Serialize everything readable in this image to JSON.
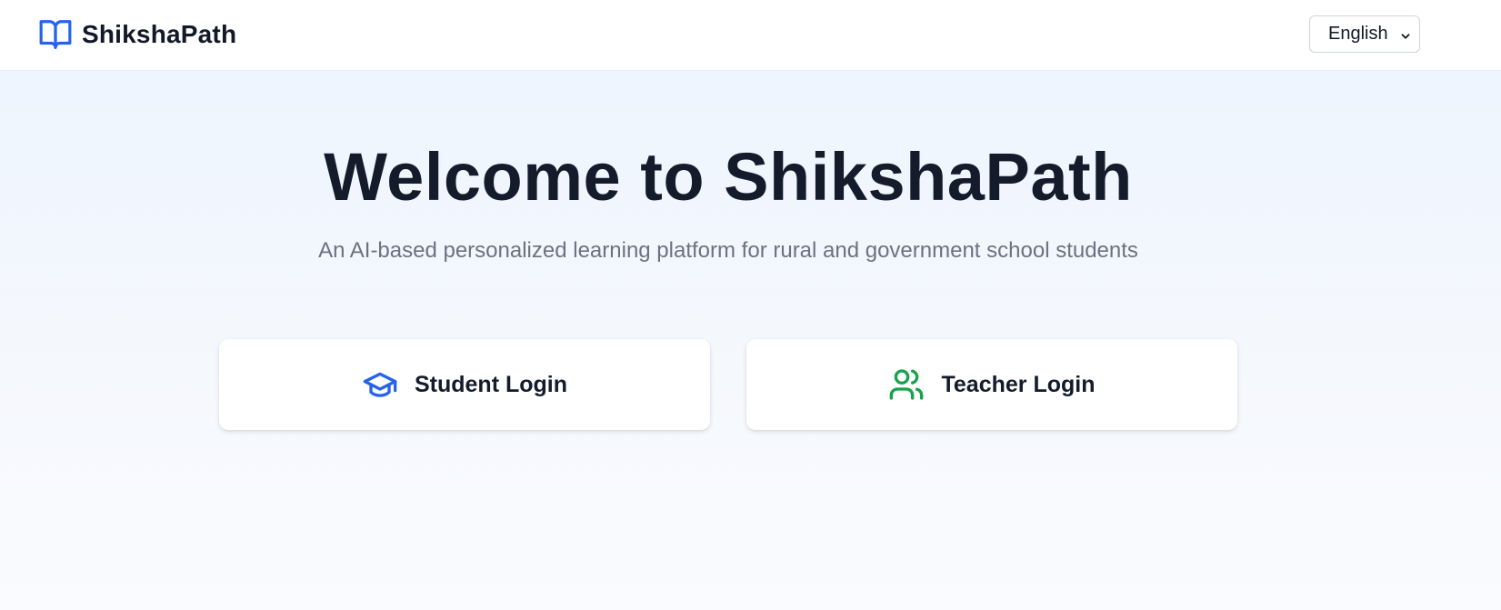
{
  "header": {
    "brand_name": "ShikshaPath",
    "language": {
      "selected": "English"
    }
  },
  "hero": {
    "title": "Welcome to ShikshaPath",
    "subtitle": "An AI-based personalized learning platform for rural and government school students"
  },
  "login_options": {
    "student_label": "Student Login",
    "teacher_label": "Teacher Login"
  },
  "colors": {
    "brand_blue": "#2563eb",
    "teacher_green": "#16a34a",
    "heading": "#141b2b",
    "muted_text": "#6b7280"
  },
  "icons": {
    "brand": "book-open-icon",
    "student": "graduation-cap-icon",
    "teacher": "users-icon",
    "language_dropdown": "chevron-down-icon"
  }
}
